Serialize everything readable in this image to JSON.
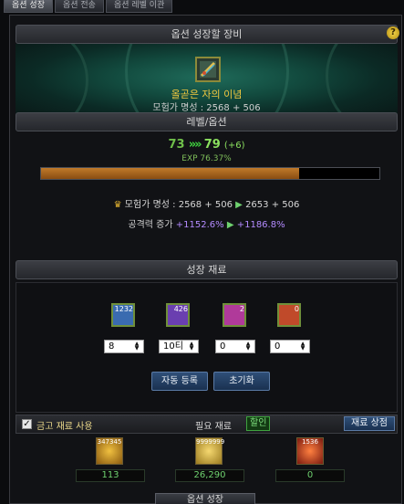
{
  "tabs": [
    {
      "label": "옵션 성장",
      "active": true
    },
    {
      "label": "옵션 전송",
      "active": false
    },
    {
      "label": "옵션 레벨 이관",
      "active": false
    }
  ],
  "equipment": {
    "header": "옵션 성장할 장비",
    "item_name": "올곧은 자의 이념",
    "fame_text": "모험가 명성 : 2568 + 506"
  },
  "level": {
    "header": "레벨/옵션",
    "current": "73",
    "arrow": "»»",
    "next": "79",
    "bonus": "(+6)",
    "exp_text": "EXP 76.37%",
    "exp_progress": 0.7637
  },
  "stats": {
    "fame_label": "모험가 명성 : 2568 + 506",
    "fame_arrow": "▶",
    "fame_after": "2653 + 506",
    "atk_label": "공격력 증가",
    "atk_before": "+1152.6%",
    "atk_arrow": "▶",
    "atk_after": "+1186.8%"
  },
  "materials": {
    "header": "성장 재료",
    "items": [
      {
        "count": "1232",
        "amount": "8",
        "color": "#3a6bb0"
      },
      {
        "count": "426",
        "amount": "10티",
        "color": "#6a3fb0"
      },
      {
        "count": "2",
        "amount": "0",
        "color": "#b03a9a"
      },
      {
        "count": "0",
        "amount": "0",
        "color": "#c04a2a"
      }
    ],
    "auto_button": "자동 등록",
    "reset_button": "초기화"
  },
  "bottom": {
    "checkbox_label": "금고 재료 사용",
    "checkbox_checked": "✓",
    "required_label": "필요 재료",
    "discount_badge": "할인",
    "shop_button": "재료 상점",
    "costs": [
      {
        "top": "347345",
        "value": "113",
        "icon": "gem-icon",
        "color": "#d8a020"
      },
      {
        "top": "9999999",
        "value": "26,290",
        "icon": "gold-icon",
        "color": "#e0b840"
      },
      {
        "top": "1536",
        "value": "0",
        "icon": "burst-icon",
        "color": "#c04020"
      }
    ]
  },
  "grow_button": "옵션 성장"
}
